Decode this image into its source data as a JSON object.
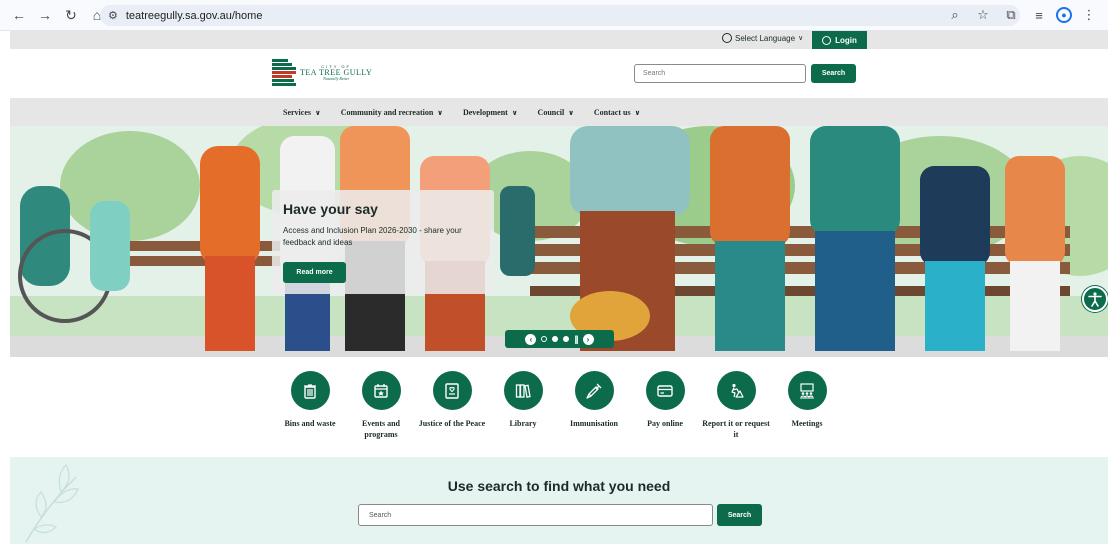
{
  "browser": {
    "url": "teatreegully.sa.gov.au/home"
  },
  "util": {
    "language_label": "Select Language",
    "login_label": "Login"
  },
  "header": {
    "logo_line1": "CITY OF",
    "logo_line2": "TEA TREE GULLY",
    "logo_line3": "Naturally Better",
    "search_placeholder": "Search",
    "search_button": "Search"
  },
  "nav": {
    "items": [
      {
        "label": "Services"
      },
      {
        "label": "Community and recreation"
      },
      {
        "label": "Development"
      },
      {
        "label": "Council"
      },
      {
        "label": "Contact us"
      }
    ]
  },
  "hero": {
    "title": "Have your say",
    "text": "Access and Inclusion Plan 2026-2030 - share your feedback and ideas",
    "button": "Read more"
  },
  "quicklinks": [
    {
      "label": "Bins and waste",
      "icon": "bin-icon"
    },
    {
      "label": "Events and programs",
      "icon": "calendar-star-icon"
    },
    {
      "label": "Justice of the Peace",
      "icon": "certificate-icon"
    },
    {
      "label": "Library",
      "icon": "books-icon"
    },
    {
      "label": "Immunisation",
      "icon": "syringe-icon"
    },
    {
      "label": "Pay online",
      "icon": "card-icon"
    },
    {
      "label": "Report it or request it",
      "icon": "roadwork-icon"
    },
    {
      "label": "Meetings",
      "icon": "meeting-icon"
    }
  ],
  "search_band": {
    "heading": "Use search to find what you need",
    "placeholder": "Search",
    "button": "Search"
  },
  "colors": {
    "brand_green": "#0b6b4b",
    "band_bg": "#e5f3f1",
    "nav_bg": "#e6e6e6"
  }
}
